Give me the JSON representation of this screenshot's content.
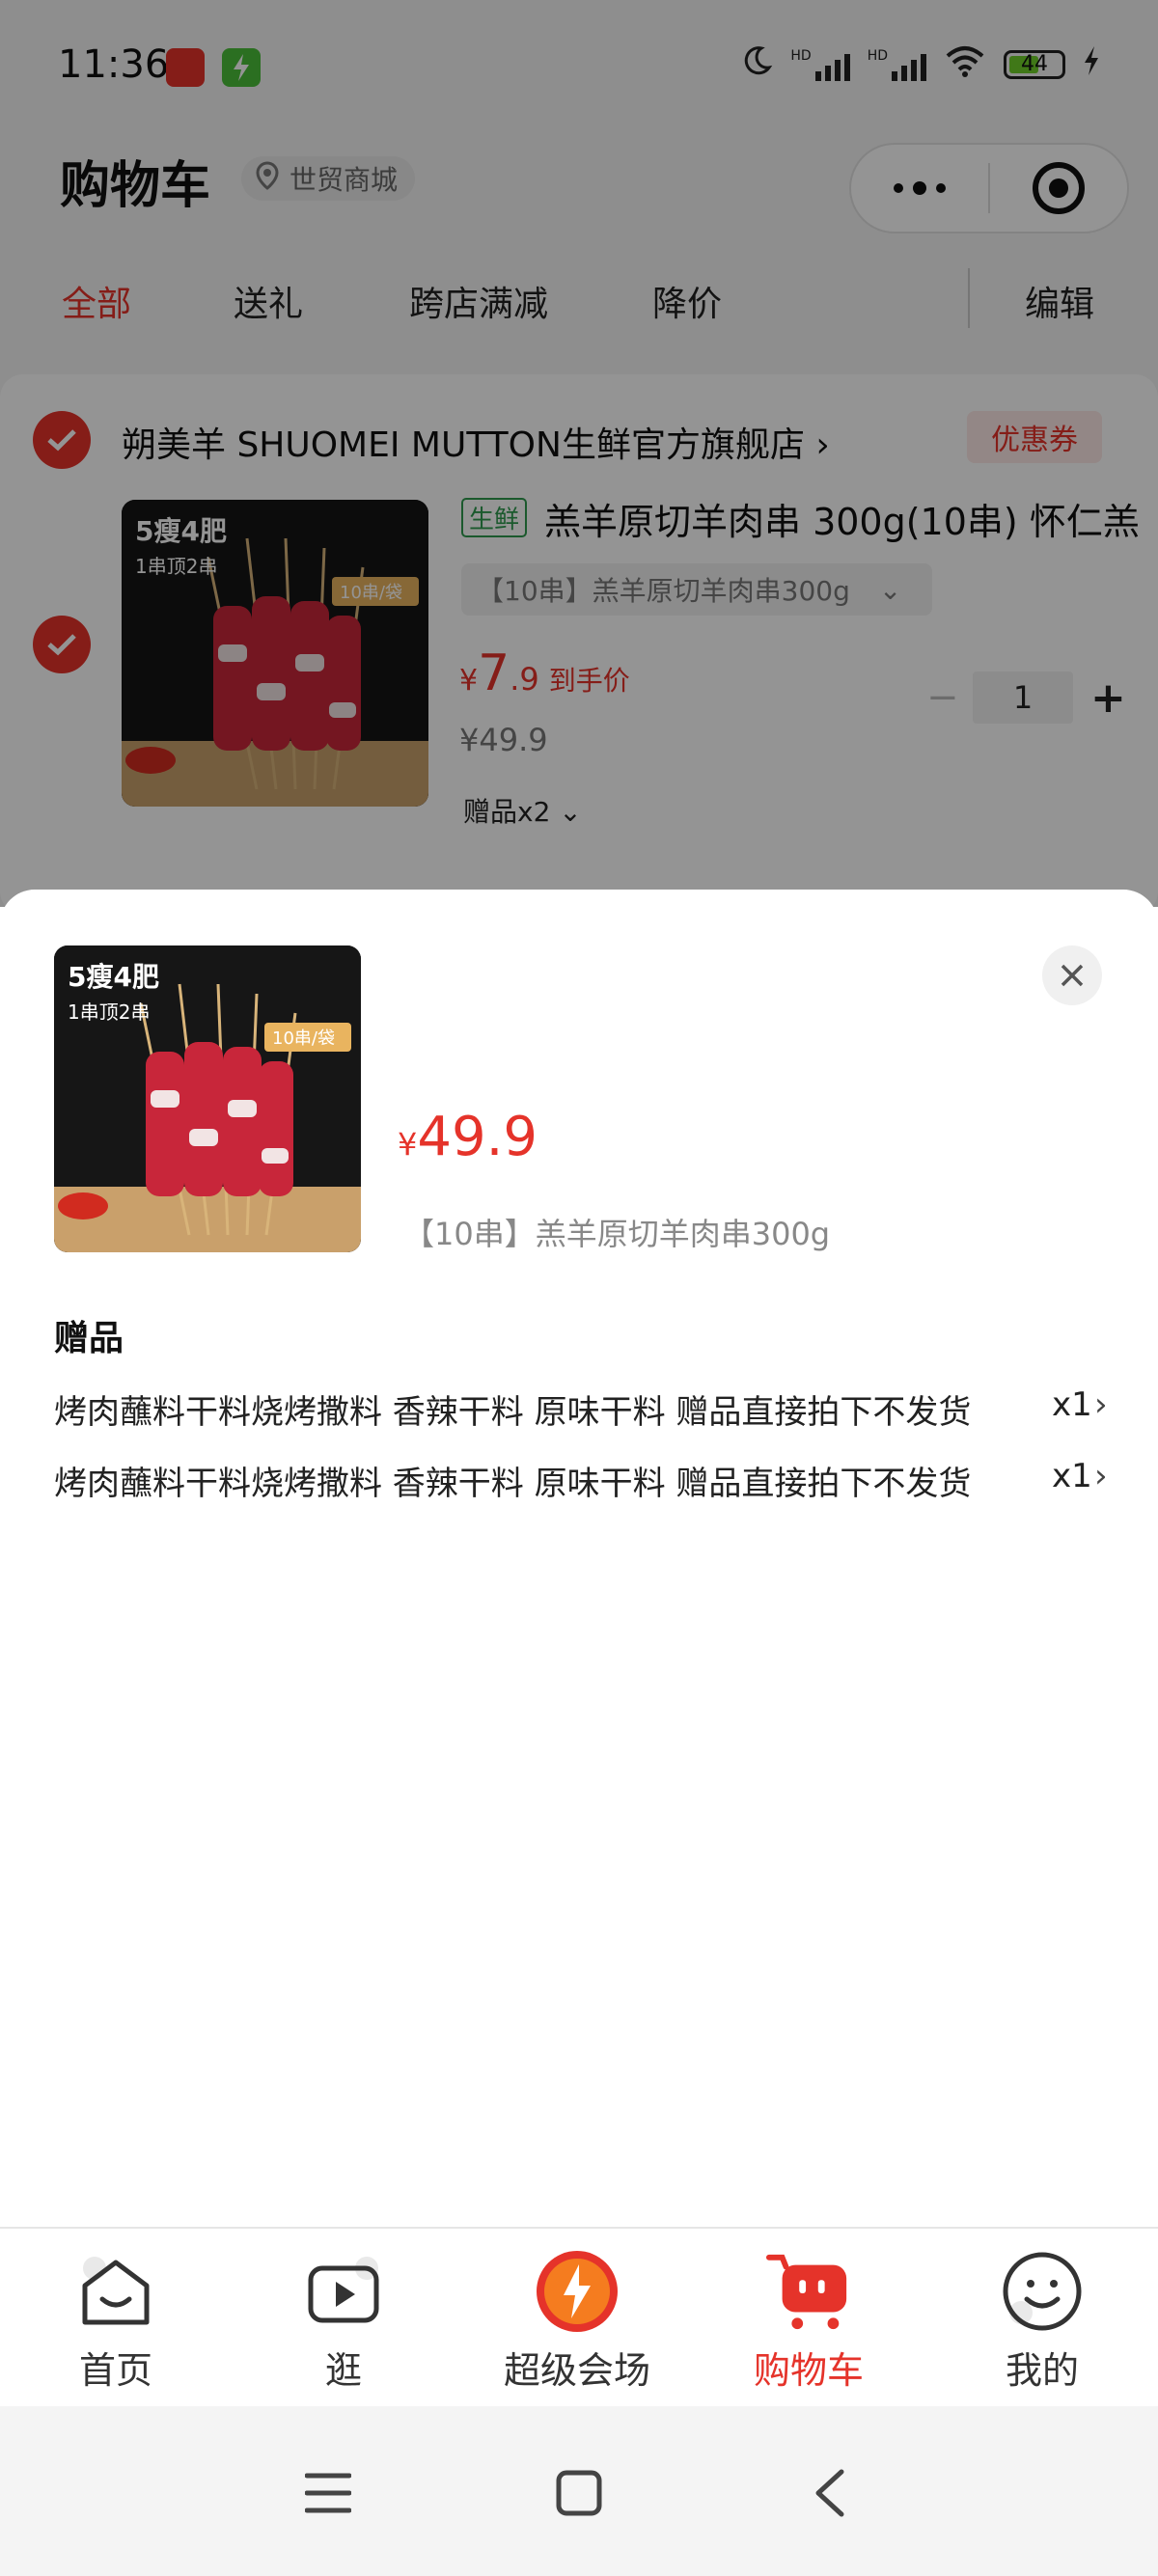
{
  "status_bar": {
    "time": "11:36",
    "battery": "44",
    "network_labels": [
      "HD",
      "HD"
    ]
  },
  "header": {
    "title": "购物车",
    "location": "世贸商城"
  },
  "tabs": [
    {
      "label": "全部",
      "active": true
    },
    {
      "label": "送礼",
      "active": false
    },
    {
      "label": "跨店满减",
      "active": false
    },
    {
      "label": "降价",
      "active": false
    }
  ],
  "edit_label": "编辑",
  "store": {
    "name": "朔美羊 SHUOMEI MUTTON生鲜官方旗舰店",
    "coupon_label": "优惠券",
    "product": {
      "tag": "生鲜",
      "title": "羔羊原切羊肉串 300g(10串) 怀仁羔",
      "spec": "【10串】羔羊原切羊肉串300g",
      "price_currency": "¥",
      "price_int": "7",
      "price_dec": ".9",
      "price_label": "到手价",
      "original_price": "¥49.9",
      "gift_toggle": "赠品x2",
      "quantity": "1",
      "image_text_1": "5瘦4肥",
      "image_text_2": "1串顶2串",
      "image_badge": "10串/袋"
    }
  },
  "sheet": {
    "price_currency": "¥",
    "price": "49.9",
    "spec": "【10串】羔羊原切羊肉串300g",
    "image_text_1": "5瘦4肥",
    "image_text_2": "1串顶2串",
    "image_badge": "10串/袋",
    "gift_title": "赠品",
    "gifts": [
      {
        "name": "烤肉蘸料干料烧烤撒料 香辣干料 原味干料 赠品直接拍下不发货",
        "count": "x1"
      },
      {
        "name": "烤肉蘸料干料烧烤撒料 香辣干料 原味干料 赠品直接拍下不发货",
        "count": "x1"
      }
    ]
  },
  "bottom_nav": [
    {
      "label": "首页",
      "icon": "home-icon",
      "active": false
    },
    {
      "label": "逛",
      "icon": "play-icon",
      "active": false
    },
    {
      "label": "超级会场",
      "icon": "super-venue-icon",
      "active": false
    },
    {
      "label": "购物车",
      "icon": "cart-icon",
      "active": true
    },
    {
      "label": "我的",
      "icon": "smile-icon",
      "active": false
    }
  ],
  "colors": {
    "accent": "#e5332a",
    "fresh_tag": "#2f9a4f"
  }
}
